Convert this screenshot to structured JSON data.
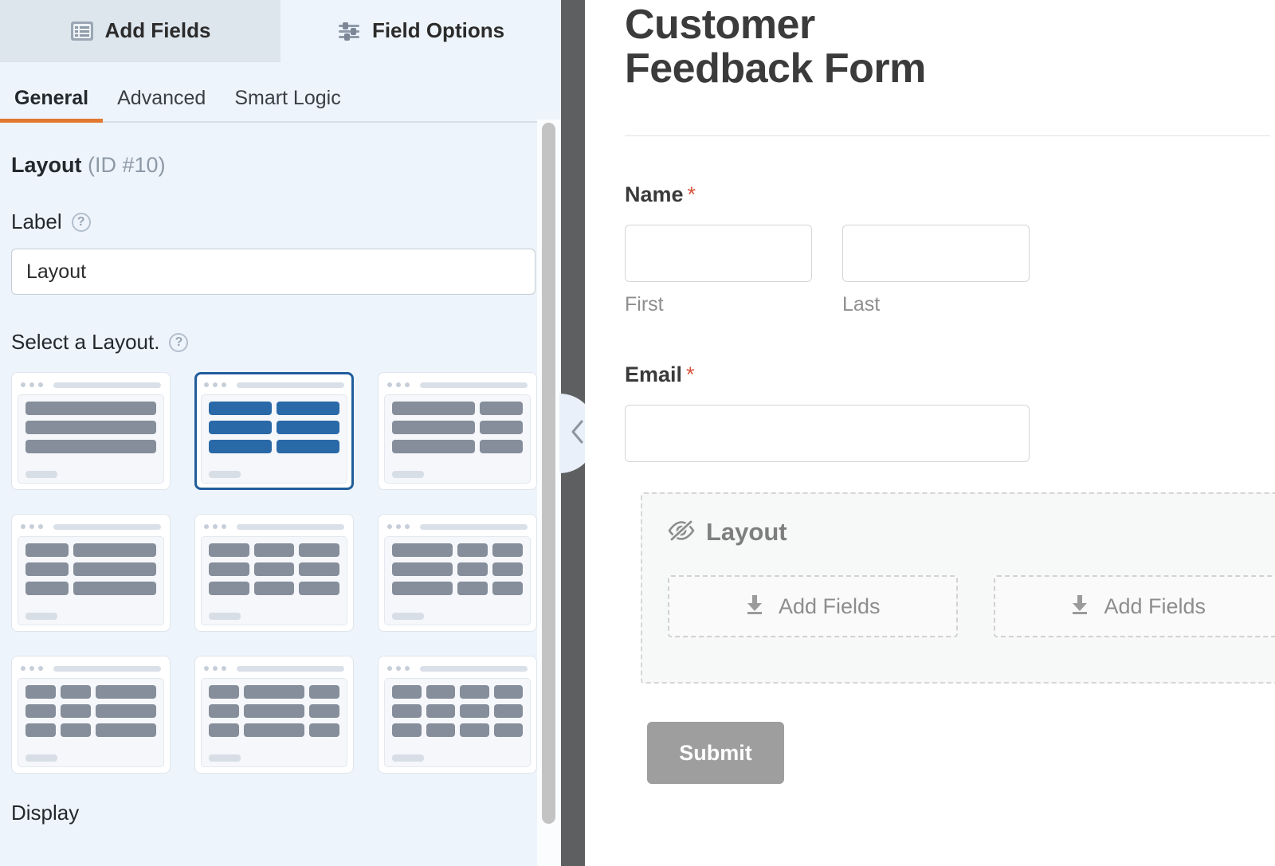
{
  "panel": {
    "tabs": [
      {
        "label": "Add Fields",
        "icon": "list-icon",
        "active": false
      },
      {
        "label": "Field Options",
        "icon": "sliders-icon",
        "active": true
      }
    ],
    "sub_tabs": [
      {
        "label": "General",
        "active": true
      },
      {
        "label": "Advanced",
        "active": false
      },
      {
        "label": "Smart Logic",
        "active": false
      }
    ],
    "field_title": "Layout",
    "field_id": "(ID #10)",
    "label_heading": "Label",
    "label_value": "Layout",
    "label_placeholder": "Layout",
    "select_layout_heading": "Select a Layout.",
    "display_heading": "Display",
    "help_icon_glyph": "?",
    "selected_layout_index": 1,
    "accent_color": "#e27730",
    "selected_color": "#215d9c",
    "selected_fill": "#2a69a8",
    "layouts": [
      {
        "name": "one-column",
        "rows": [
          [
            100
          ],
          [
            100
          ],
          [
            100
          ]
        ]
      },
      {
        "name": "two-columns-equal",
        "rows": [
          [
            50,
            50
          ],
          [
            50,
            50
          ],
          [
            50,
            50
          ]
        ]
      },
      {
        "name": "two-columns-wide-narrow",
        "rows": [
          [
            66,
            34
          ],
          [
            66,
            34
          ],
          [
            66,
            34
          ]
        ]
      },
      {
        "name": "two-columns-narrow-wide",
        "rows": [
          [
            34,
            66
          ],
          [
            34,
            66
          ],
          [
            34,
            66
          ]
        ]
      },
      {
        "name": "three-columns-equal",
        "rows": [
          [
            33,
            33,
            33
          ],
          [
            33,
            33,
            33
          ],
          [
            33,
            33,
            33
          ]
        ]
      },
      {
        "name": "three-columns-wide-first",
        "rows": [
          [
            50,
            25,
            25
          ],
          [
            50,
            25,
            25
          ],
          [
            50,
            25,
            25
          ]
        ]
      },
      {
        "name": "three-columns-wide-last",
        "rows": [
          [
            25,
            25,
            50
          ],
          [
            25,
            25,
            50
          ],
          [
            25,
            25,
            50
          ]
        ]
      },
      {
        "name": "three-columns-wide-middle",
        "rows": [
          [
            25,
            50,
            25
          ],
          [
            25,
            50,
            25
          ],
          [
            25,
            50,
            25
          ]
        ]
      },
      {
        "name": "four-columns-equal",
        "rows": [
          [
            25,
            25,
            25,
            25
          ],
          [
            25,
            25,
            25,
            25
          ],
          [
            25,
            25,
            25,
            25
          ]
        ]
      }
    ]
  },
  "divider": {
    "collapse_icon": "chevron-left-icon"
  },
  "preview": {
    "form_title": "Customer Feedback Form",
    "fields": [
      {
        "label": "Name",
        "required_marker": "*",
        "inputs": [
          {
            "value": "",
            "sublabel": "First"
          },
          {
            "value": "",
            "sublabel": "Last"
          }
        ]
      },
      {
        "label": "Email",
        "required_marker": "*",
        "inputs": [
          {
            "value": "",
            "sublabel": ""
          }
        ]
      }
    ],
    "layout_field": {
      "title": "Layout",
      "icon": "eye-slash-icon",
      "columns": [
        {
          "label": "Add Fields",
          "icon": "download-icon"
        },
        {
          "label": "Add Fields",
          "icon": "download-icon"
        }
      ]
    },
    "submit_label": "Submit"
  },
  "annotation": {
    "type": "curved-arrow",
    "color": "#ed2024"
  }
}
